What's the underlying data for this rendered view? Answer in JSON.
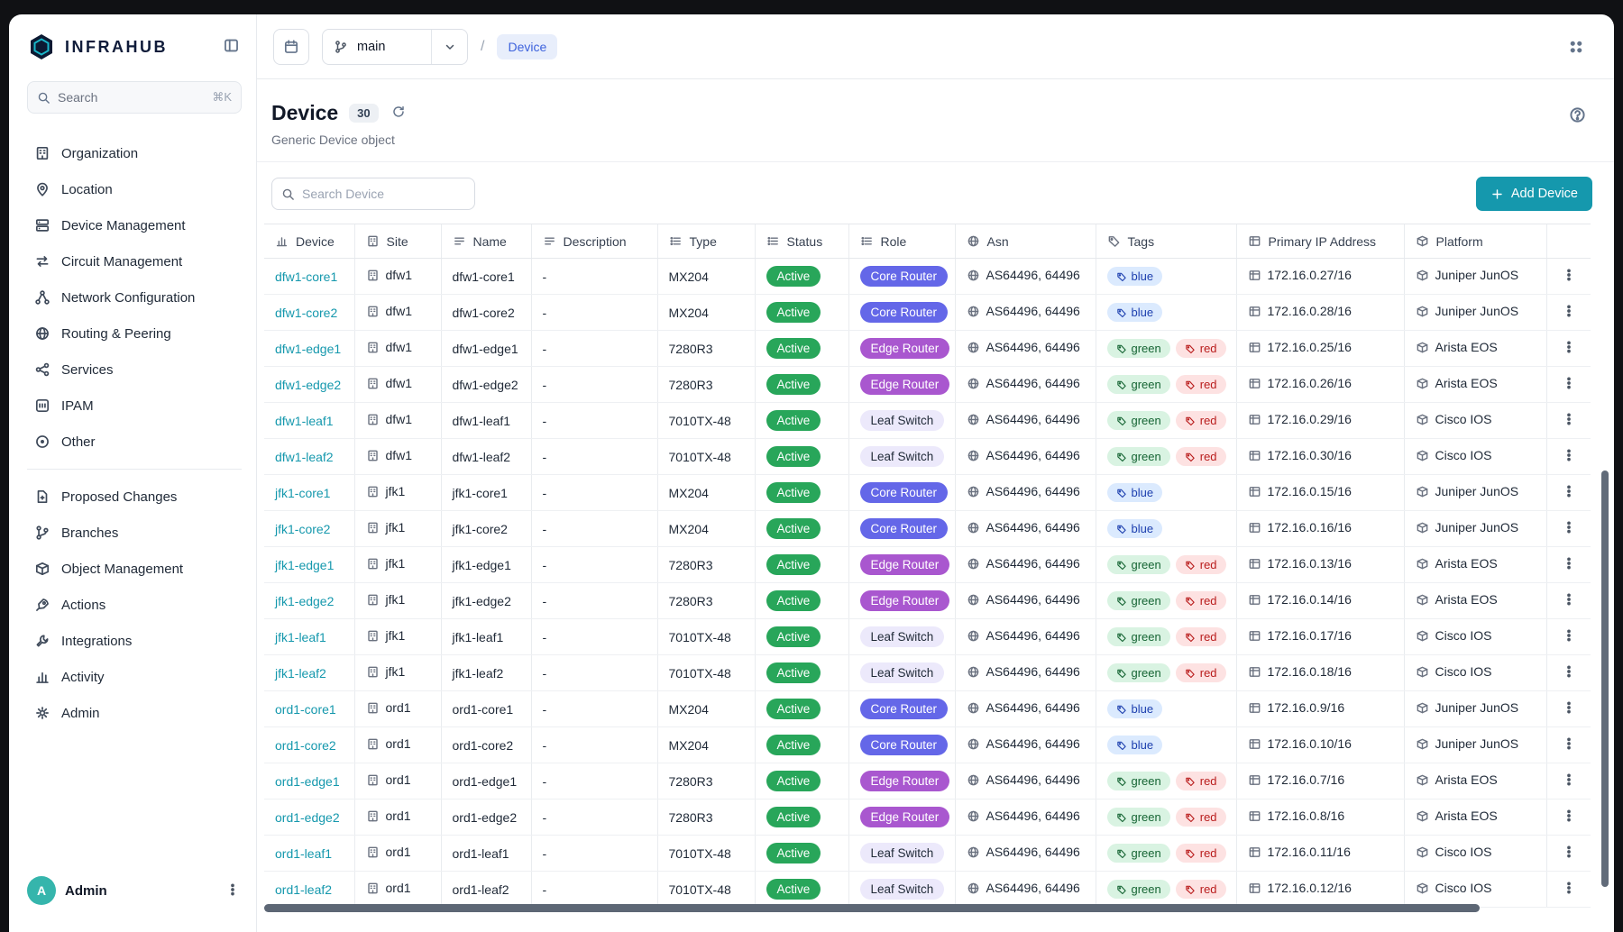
{
  "colors": {
    "accent_teal": "#1598ad",
    "link_teal": "#1598ad",
    "status_active_green": "#28a65a",
    "role_core_router": "#6467e8",
    "role_edge_router": "#a957cf",
    "role_leaf_switch_bg": "#ece9fb",
    "tag_blue_bg": "#dbeafe",
    "tag_blue_text": "#1e40af",
    "tag_green_bg": "#d9f3e2",
    "tag_green_text": "#166534",
    "tag_red_bg": "#fde2e2",
    "tag_red_text": "#b91c1c",
    "breadcrumb_chip_bg": "#e8eefb",
    "breadcrumb_chip_text": "#3e63dd",
    "avatar_bg": "#35b5ac"
  },
  "sidebar": {
    "logo_text": "INFRAHUB",
    "search_label": "Search",
    "search_shortcut": "⌘K",
    "groups": [
      {
        "items": [
          {
            "label": "Organization",
            "icon": "building-icon"
          },
          {
            "label": "Location",
            "icon": "map-pin-icon"
          },
          {
            "label": "Device Management",
            "icon": "server-icon"
          },
          {
            "label": "Circuit Management",
            "icon": "switch-arrows-icon"
          },
          {
            "label": "Network Configuration",
            "icon": "hierarchy-icon"
          },
          {
            "label": "Routing & Peering",
            "icon": "globe-icon"
          },
          {
            "label": "Services",
            "icon": "share-nodes-icon"
          },
          {
            "label": "IPAM",
            "icon": "network-grid-icon"
          },
          {
            "label": "Other",
            "icon": "circle-dot-icon"
          }
        ]
      },
      {
        "items": [
          {
            "label": "Proposed Changes",
            "icon": "file-diff-icon"
          },
          {
            "label": "Branches",
            "icon": "git-branch-icon"
          },
          {
            "label": "Object Management",
            "icon": "cube-icon"
          },
          {
            "label": "Actions",
            "icon": "rocket-icon"
          },
          {
            "label": "Integrations",
            "icon": "tool-icon"
          },
          {
            "label": "Activity",
            "icon": "bar-chart-icon"
          },
          {
            "label": "Admin",
            "icon": "gear-icon"
          }
        ]
      }
    ],
    "user": {
      "name": "Admin",
      "avatar_initial": "A"
    }
  },
  "topbar": {
    "branch_name": "main",
    "breadcrumb_separator": "/",
    "breadcrumb_current": "Device"
  },
  "page": {
    "title": "Device",
    "count": "30",
    "subtitle": "Generic Device object"
  },
  "toolbar": {
    "search_placeholder": "Search Device",
    "add_button_label": "Add Device"
  },
  "table": {
    "columns": [
      {
        "label": "Device",
        "icon": "bar-chart-icon"
      },
      {
        "label": "Site",
        "icon": "building-icon"
      },
      {
        "label": "Name",
        "icon": "text-icon"
      },
      {
        "label": "Description",
        "icon": "text-icon"
      },
      {
        "label": "Type",
        "icon": "list-icon"
      },
      {
        "label": "Status",
        "icon": "list-icon"
      },
      {
        "label": "Role",
        "icon": "list-icon"
      },
      {
        "label": "Asn",
        "icon": "globe-icon"
      },
      {
        "label": "Tags",
        "icon": "tag-icon"
      },
      {
        "label": "Primary IP Address",
        "icon": "table-grid-icon"
      },
      {
        "label": "Platform",
        "icon": "cube-icon"
      }
    ],
    "role_styles": {
      "Core Router": "core",
      "Edge Router": "edge",
      "Leaf Switch": "leaf"
    },
    "rows": [
      {
        "device": "dfw1-core1",
        "site": "dfw1",
        "name": "dfw1-core1",
        "description": "-",
        "type": "MX204",
        "status": "Active",
        "role": "Core Router",
        "asn": "AS64496, 64496",
        "tags": [
          "blue"
        ],
        "ip": "172.16.0.27/16",
        "platform": "Juniper JunOS"
      },
      {
        "device": "dfw1-core2",
        "site": "dfw1",
        "name": "dfw1-core2",
        "description": "-",
        "type": "MX204",
        "status": "Active",
        "role": "Core Router",
        "asn": "AS64496, 64496",
        "tags": [
          "blue"
        ],
        "ip": "172.16.0.28/16",
        "platform": "Juniper JunOS"
      },
      {
        "device": "dfw1-edge1",
        "site": "dfw1",
        "name": "dfw1-edge1",
        "description": "-",
        "type": "7280R3",
        "status": "Active",
        "role": "Edge Router",
        "asn": "AS64496, 64496",
        "tags": [
          "green",
          "red"
        ],
        "ip": "172.16.0.25/16",
        "platform": "Arista EOS"
      },
      {
        "device": "dfw1-edge2",
        "site": "dfw1",
        "name": "dfw1-edge2",
        "description": "-",
        "type": "7280R3",
        "status": "Active",
        "role": "Edge Router",
        "asn": "AS64496, 64496",
        "tags": [
          "green",
          "red"
        ],
        "ip": "172.16.0.26/16",
        "platform": "Arista EOS"
      },
      {
        "device": "dfw1-leaf1",
        "site": "dfw1",
        "name": "dfw1-leaf1",
        "description": "-",
        "type": "7010TX-48",
        "status": "Active",
        "role": "Leaf Switch",
        "asn": "AS64496, 64496",
        "tags": [
          "green",
          "red"
        ],
        "ip": "172.16.0.29/16",
        "platform": "Cisco IOS"
      },
      {
        "device": "dfw1-leaf2",
        "site": "dfw1",
        "name": "dfw1-leaf2",
        "description": "-",
        "type": "7010TX-48",
        "status": "Active",
        "role": "Leaf Switch",
        "asn": "AS64496, 64496",
        "tags": [
          "green",
          "red"
        ],
        "ip": "172.16.0.30/16",
        "platform": "Cisco IOS"
      },
      {
        "device": "jfk1-core1",
        "site": "jfk1",
        "name": "jfk1-core1",
        "description": "-",
        "type": "MX204",
        "status": "Active",
        "role": "Core Router",
        "asn": "AS64496, 64496",
        "tags": [
          "blue"
        ],
        "ip": "172.16.0.15/16",
        "platform": "Juniper JunOS"
      },
      {
        "device": "jfk1-core2",
        "site": "jfk1",
        "name": "jfk1-core2",
        "description": "-",
        "type": "MX204",
        "status": "Active",
        "role": "Core Router",
        "asn": "AS64496, 64496",
        "tags": [
          "blue"
        ],
        "ip": "172.16.0.16/16",
        "platform": "Juniper JunOS"
      },
      {
        "device": "jfk1-edge1",
        "site": "jfk1",
        "name": "jfk1-edge1",
        "description": "-",
        "type": "7280R3",
        "status": "Active",
        "role": "Edge Router",
        "asn": "AS64496, 64496",
        "tags": [
          "green",
          "red"
        ],
        "ip": "172.16.0.13/16",
        "platform": "Arista EOS"
      },
      {
        "device": "jfk1-edge2",
        "site": "jfk1",
        "name": "jfk1-edge2",
        "description": "-",
        "type": "7280R3",
        "status": "Active",
        "role": "Edge Router",
        "asn": "AS64496, 64496",
        "tags": [
          "green",
          "red"
        ],
        "ip": "172.16.0.14/16",
        "platform": "Arista EOS"
      },
      {
        "device": "jfk1-leaf1",
        "site": "jfk1",
        "name": "jfk1-leaf1",
        "description": "-",
        "type": "7010TX-48",
        "status": "Active",
        "role": "Leaf Switch",
        "asn": "AS64496, 64496",
        "tags": [
          "green",
          "red"
        ],
        "ip": "172.16.0.17/16",
        "platform": "Cisco IOS"
      },
      {
        "device": "jfk1-leaf2",
        "site": "jfk1",
        "name": "jfk1-leaf2",
        "description": "-",
        "type": "7010TX-48",
        "status": "Active",
        "role": "Leaf Switch",
        "asn": "AS64496, 64496",
        "tags": [
          "green",
          "red"
        ],
        "ip": "172.16.0.18/16",
        "platform": "Cisco IOS"
      },
      {
        "device": "ord1-core1",
        "site": "ord1",
        "name": "ord1-core1",
        "description": "-",
        "type": "MX204",
        "status": "Active",
        "role": "Core Router",
        "asn": "AS64496, 64496",
        "tags": [
          "blue"
        ],
        "ip": "172.16.0.9/16",
        "platform": "Juniper JunOS"
      },
      {
        "device": "ord1-core2",
        "site": "ord1",
        "name": "ord1-core2",
        "description": "-",
        "type": "MX204",
        "status": "Active",
        "role": "Core Router",
        "asn": "AS64496, 64496",
        "tags": [
          "blue"
        ],
        "ip": "172.16.0.10/16",
        "platform": "Juniper JunOS"
      },
      {
        "device": "ord1-edge1",
        "site": "ord1",
        "name": "ord1-edge1",
        "description": "-",
        "type": "7280R3",
        "status": "Active",
        "role": "Edge Router",
        "asn": "AS64496, 64496",
        "tags": [
          "green",
          "red"
        ],
        "ip": "172.16.0.7/16",
        "platform": "Arista EOS"
      },
      {
        "device": "ord1-edge2",
        "site": "ord1",
        "name": "ord1-edge2",
        "description": "-",
        "type": "7280R3",
        "status": "Active",
        "role": "Edge Router",
        "asn": "AS64496, 64496",
        "tags": [
          "green",
          "red"
        ],
        "ip": "172.16.0.8/16",
        "platform": "Arista EOS"
      },
      {
        "device": "ord1-leaf1",
        "site": "ord1",
        "name": "ord1-leaf1",
        "description": "-",
        "type": "7010TX-48",
        "status": "Active",
        "role": "Leaf Switch",
        "asn": "AS64496, 64496",
        "tags": [
          "green",
          "red"
        ],
        "ip": "172.16.0.11/16",
        "platform": "Cisco IOS"
      },
      {
        "device": "ord1-leaf2",
        "site": "ord1",
        "name": "ord1-leaf2",
        "description": "-",
        "type": "7010TX-48",
        "status": "Active",
        "role": "Leaf Switch",
        "asn": "AS64496, 64496",
        "tags": [
          "green",
          "red"
        ],
        "ip": "172.16.0.12/16",
        "platform": "Cisco IOS"
      }
    ]
  }
}
